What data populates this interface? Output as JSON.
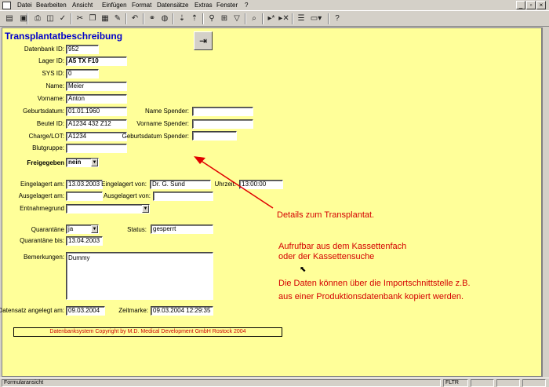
{
  "menubar": {
    "items": [
      "Datei",
      "Bearbeiten",
      "Ansicht",
      "Einfügen",
      "Format",
      "Datensätze",
      "Extras",
      "Fenster",
      "?"
    ],
    "window_buttons": [
      "_",
      "▫",
      "×"
    ]
  },
  "toolbar": {
    "icons": [
      "view-icon",
      "save-icon",
      "print-icon",
      "print-preview-icon",
      "spellcheck-icon",
      "cut-icon",
      "copy-icon",
      "paste-icon",
      "format-painter-icon",
      "undo-icon",
      "hyperlink-icon",
      "web-icon",
      "sort-ascending-icon",
      "sort-descending-icon",
      "filter-by-selection-icon",
      "filter-by-form-icon",
      "apply-filter-icon",
      "find-icon",
      "new-record-icon",
      "delete-record-icon",
      "properties-icon",
      "database-window-icon",
      "new-object-icon",
      "help-icon"
    ]
  },
  "form": {
    "title": "Transplantatbeschreibung",
    "labels": {
      "datenbank_id": "Datenbank ID:",
      "lager_id": "Lager ID:",
      "sys_id": "SYS ID:",
      "name": "Name:",
      "vorname": "Vorname:",
      "geburtsdatum": "Geburtsdatum:",
      "beutel_id": "Beutel ID:",
      "charge_lot": "Charge/LOT:",
      "blutgruppe": "Blutgruppe:",
      "name_spender": "Name Spender:",
      "vorname_spender": "Vorname Spender:",
      "geburtsdatum_spender": "Geburtsdatum Spender:",
      "freigegeben": "Freigegeben",
      "eingelagert_am": "Eingelagert am:",
      "eingelagert_von": "Eingelagert von:",
      "uhrzeit": "Uhrzeit:",
      "ausgelagert_am": "Ausgelagert am:",
      "ausgelagert_von": "Ausgelagert von:",
      "entnahmegrund": "Entnahmegrund",
      "quarantaene": "Quarantäne",
      "status": "Status:",
      "quarantaene_bis": "Quarantäne bis:",
      "bemerkungen": "Bemerkungen:",
      "datensatz_angelegt": "Datensatz angelegt am:",
      "zeitmarke": "Zeitmarke:"
    },
    "values": {
      "datenbank_id": "952",
      "lager_id": "A5 TX F10",
      "sys_id": "0",
      "name": "Meier",
      "vorname": "Anton",
      "geburtsdatum": "01.01.1960",
      "beutel_id": "A1234 432 Z12",
      "charge_lot": "A1234",
      "blutgruppe": "",
      "name_spender": "",
      "vorname_spender": "",
      "geburtsdatum_spender": "",
      "freigegeben": "nein",
      "eingelagert_am": "13.03.2003",
      "eingelagert_von": "Dr. G. Sund",
      "uhrzeit": "13:00:00",
      "ausgelagert_am": "",
      "ausgelagert_von": "",
      "entnahmegrund": "",
      "quarantaene": "ja",
      "status": "gesperrt",
      "quarantaene_bis": "13.04.2003",
      "bemerkungen": "Dummy",
      "datensatz_angelegt": "09.03.2004",
      "zeitmarke": "09.03.2004 12:29:35"
    },
    "copyright": "Datenbanksystem Copyright by M.D. Medical Development GmbH Rostock 2004"
  },
  "annotation": {
    "line1": "Details zum Transplantat.",
    "line2": "Aufrufbar aus dem Kassettenfach",
    "line3": "oder der Kassettensuche",
    "line4": "Die Daten können über die Importschnittstelle z.B.",
    "line5": "aus einer Produktionsdatenbank kopiert werden."
  },
  "statusbar": {
    "mode": "Formularansicht",
    "indicator": "FLTR"
  },
  "colors": {
    "form_background": "#ffff99",
    "title": "#0000cc",
    "annotation": "#d40000",
    "arrow": "#e00000"
  }
}
